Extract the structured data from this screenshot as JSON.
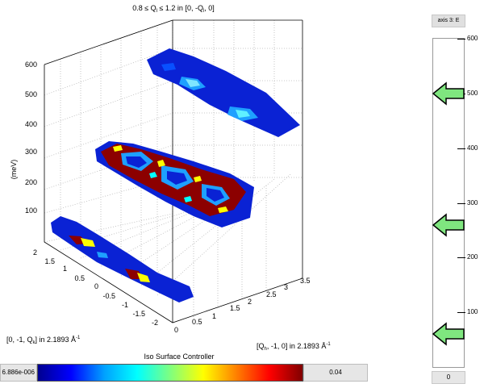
{
  "plot": {
    "title_pre": "0.8 ≤ Q",
    "title_sub1": "l",
    "title_mid": " ≤ 1.2 in [0, -Q",
    "title_sub2": "l",
    "title_post": ", 0]",
    "z_label": "(meV)",
    "z_ticks": [
      "100",
      "200",
      "300",
      "400",
      "500",
      "600"
    ],
    "y_ticks": [
      "2",
      "1.5",
      "1",
      "0.5",
      "0",
      "-0.5",
      "-1",
      "-1.5",
      "-2"
    ],
    "x_ticks": [
      "0",
      "0.5",
      "1",
      "1.5",
      "2",
      "2.5",
      "3",
      "3.5"
    ],
    "left_label_pre": "[0, -1, Q",
    "left_label_sub": "k",
    "left_label_mid": "] in 2.1893 Å",
    "left_label_sup": "-1",
    "right_label_pre": "[Q",
    "right_label_sub": "h",
    "right_label_mid": ", -1, 0] in 2.1893 Å",
    "right_label_sup": "-1"
  },
  "iso_controller": {
    "title": "Iso Surface Controller",
    "min_value": "6.886e-006",
    "max_value": "0.04",
    "colormap": [
      "#00008f",
      "#0000ff",
      "#00a0ff",
      "#00ffff",
      "#7fff7f",
      "#ffff00",
      "#ff8000",
      "#ff0000",
      "#800000"
    ]
  },
  "axis_slider": {
    "header": "axis 3: E",
    "footer": "0",
    "ticks": [
      "600",
      "500",
      "400",
      "300",
      "200",
      "100"
    ],
    "markers": [
      500,
      260,
      60
    ],
    "range": [
      0,
      600
    ],
    "marker_color": "#7fe67f"
  },
  "colors": {
    "deep_blue": "#0a1fd6",
    "light_blue": "#1ea0ff",
    "cyan": "#00ffff",
    "yellow": "#ffff00",
    "dark_red": "#8c0000"
  }
}
